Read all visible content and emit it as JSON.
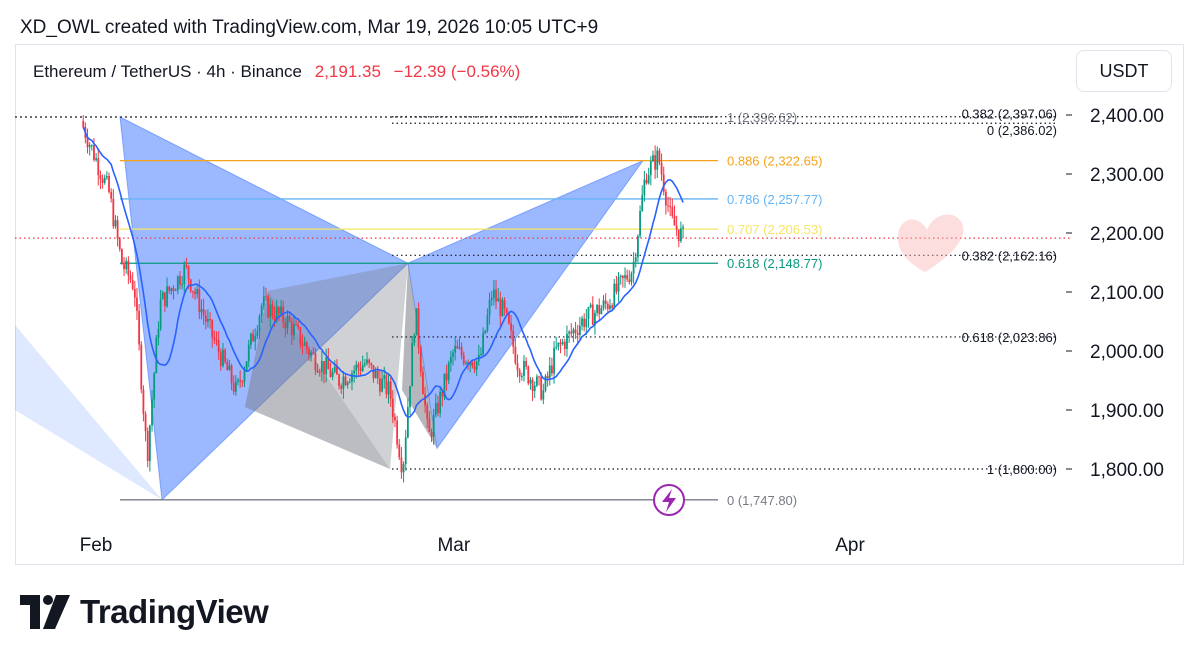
{
  "header": {
    "attribution": "XD_OWL created with TradingView.com, Mar 19, 2026 10:05 UTC+9"
  },
  "legend": {
    "symbol": "Ethereum / TetherUS · 4h · Binance",
    "price": "2,191.35",
    "change": "−12.39 (−0.56%)"
  },
  "currency_button": "USDT",
  "brand": {
    "name": "TradingView"
  },
  "colors": {
    "bear": "#f23645",
    "bull": "#089981",
    "ma": "#2962ff",
    "pattern_blue": "#4a7dff",
    "pattern_gray": "#787b86",
    "fib_0886": "#f7a21b",
    "fib_0786": "#64b5f6",
    "fib_0707": "#f5e663",
    "fib_0618": "#089981",
    "dotted": "#131722",
    "red_dotted": "#f23645",
    "alert": "#9c27b0"
  },
  "chart_data": {
    "type": "candlestick",
    "symbol": "ETHUSDT",
    "timeframe": "4h",
    "ylim": [
      1720,
      2470
    ],
    "y_ticks": [
      "2,400.00",
      "2,300.00",
      "2,200.00",
      "2,100.00",
      "2,000.00",
      "1,900.00",
      "1,800.00"
    ],
    "y_tick_values": [
      2400,
      2300,
      2200,
      2100,
      2000,
      1900,
      1800
    ],
    "x_ticks": [
      "Feb",
      "Mar",
      "Apr"
    ],
    "current_price": 2191.35,
    "close_points": [
      [
        "Jan 31",
        2380
      ],
      [
        "Feb 2",
        2270
      ],
      [
        "Feb 3",
        2150
      ],
      [
        "Feb 4",
        2110
      ],
      [
        "Feb 5",
        1820
      ],
      [
        "Feb 6",
        2080
      ],
      [
        "Feb 8",
        2140
      ],
      [
        "Feb 10",
        2030
      ],
      [
        "Feb 12",
        1930
      ],
      [
        "Feb 14",
        2080
      ],
      [
        "Feb 16",
        2050
      ],
      [
        "Feb 18",
        1990
      ],
      [
        "Feb 20",
        1950
      ],
      [
        "Feb 22",
        1980
      ],
      [
        "Feb 24",
        1930
      ],
      [
        "Feb 25",
        1800
      ],
      [
        "Feb 26",
        2070
      ],
      [
        "Feb 27",
        1850
      ],
      [
        "Mar 1",
        2000
      ],
      [
        "Mar 3",
        1980
      ],
      [
        "Mar 4",
        2100
      ],
      [
        "Mar 5",
        2060
      ],
      [
        "Mar 6",
        1980
      ],
      [
        "Mar 8",
        1930
      ],
      [
        "Mar 9",
        2000
      ],
      [
        "Mar 11",
        2050
      ],
      [
        "Mar 13",
        2080
      ],
      [
        "Mar 15",
        2140
      ],
      [
        "Mar 16",
        2300
      ],
      [
        "Mar 17",
        2330
      ],
      [
        "Mar 18",
        2220
      ],
      [
        "Mar 19",
        2191
      ]
    ],
    "fib_left": [
      {
        "label": "1 (2,396.62)",
        "value": 2396.62
      },
      {
        "label": "0.886 (2,322.65)",
        "value": 2322.65
      },
      {
        "label": "0.786 (2,257.77)",
        "value": 2257.77
      },
      {
        "label": "0.707 (2,206.53)",
        "value": 2206.53
      },
      {
        "label": "0.618 (2,148.77)",
        "value": 2148.77
      },
      {
        "label": "0 (1,747.80)",
        "value": 1747.8
      }
    ],
    "fib_right": [
      {
        "label": "0.382 (2,397.06)",
        "value": 2397.06
      },
      {
        "label": "0 (2,386.02)",
        "value": 2386.02
      },
      {
        "label": "0.382 (2,162.16)",
        "value": 2162.16
      },
      {
        "label": "0.618 (2,023.86)",
        "value": 2023.86
      },
      {
        "label": "1 (1,800.00)",
        "value": 1800.0
      }
    ]
  }
}
